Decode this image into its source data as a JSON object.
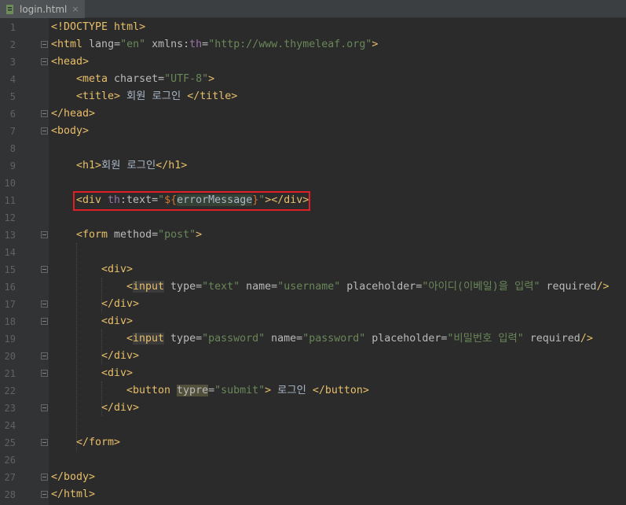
{
  "tab": {
    "filename": "login.html",
    "close_glyph": "×",
    "icon": "html-file-icon"
  },
  "highlight": {
    "line": 11,
    "color": "#e01f26"
  },
  "lines": [
    {
      "n": "1",
      "fold": false,
      "indent": 0,
      "segs": [
        [
          "tag",
          "<!DOCTYPE html>"
        ]
      ]
    },
    {
      "n": "2",
      "fold": true,
      "indent": 0,
      "segs": [
        [
          "tag",
          "<html "
        ],
        [
          "attr",
          "lang="
        ],
        [
          "str",
          "\"en\""
        ],
        [
          "attr",
          " xmlns:"
        ],
        [
          "ns",
          "th"
        ],
        [
          "attr",
          "="
        ],
        [
          "str",
          "\"http://www.thymeleaf.org\""
        ],
        [
          "tag",
          ">"
        ]
      ]
    },
    {
      "n": "3",
      "fold": true,
      "indent": 0,
      "segs": [
        [
          "tag",
          "<head>"
        ]
      ]
    },
    {
      "n": "4",
      "fold": false,
      "indent": 1,
      "segs": [
        [
          "tag",
          "<meta "
        ],
        [
          "attr",
          "charset="
        ],
        [
          "str",
          "\"UTF-8\""
        ],
        [
          "tag",
          ">"
        ]
      ]
    },
    {
      "n": "5",
      "fold": false,
      "indent": 1,
      "segs": [
        [
          "tag",
          "<title>"
        ],
        [
          "txt",
          " 회원 로그인 "
        ],
        [
          "tag",
          "</title>"
        ]
      ]
    },
    {
      "n": "6",
      "fold": true,
      "indent": 0,
      "segs": [
        [
          "tag",
          "</head>"
        ]
      ]
    },
    {
      "n": "7",
      "fold": true,
      "indent": 0,
      "segs": [
        [
          "tag",
          "<body>"
        ]
      ]
    },
    {
      "n": "8",
      "fold": false,
      "indent": 0,
      "segs": []
    },
    {
      "n": "9",
      "fold": false,
      "indent": 1,
      "segs": [
        [
          "tag",
          "<h1>"
        ],
        [
          "txt",
          "회원 로그인"
        ],
        [
          "tag",
          "</h1>"
        ]
      ]
    },
    {
      "n": "10",
      "fold": false,
      "indent": 0,
      "segs": []
    },
    {
      "n": "11",
      "fold": false,
      "indent": 1,
      "segs": [
        [
          "tag",
          "<div "
        ],
        [
          "ns",
          "th"
        ],
        [
          "attr",
          ":text="
        ],
        [
          "str",
          "\""
        ],
        [
          "dollar",
          "$"
        ],
        [
          "brace",
          "{"
        ],
        [
          "var",
          "errorMessage"
        ],
        [
          "brace",
          "}"
        ],
        [
          "str",
          "\""
        ],
        [
          "tag",
          "></div>"
        ]
      ]
    },
    {
      "n": "12",
      "fold": false,
      "indent": 0,
      "segs": []
    },
    {
      "n": "13",
      "fold": true,
      "indent": 1,
      "segs": [
        [
          "tag",
          "<form "
        ],
        [
          "attr",
          "method="
        ],
        [
          "str",
          "\"post\""
        ],
        [
          "tag",
          ">"
        ]
      ]
    },
    {
      "n": "14",
      "fold": false,
      "indent": 0,
      "segs": []
    },
    {
      "n": "15",
      "fold": true,
      "indent": 2,
      "segs": [
        [
          "tag",
          "<div>"
        ]
      ]
    },
    {
      "n": "16",
      "fold": false,
      "indent": 3,
      "segs": [
        [
          "tag",
          "<"
        ],
        [
          "tag hlw",
          "input"
        ],
        [
          "attr",
          " type="
        ],
        [
          "str",
          "\"text\""
        ],
        [
          "attr",
          " name="
        ],
        [
          "str",
          "\"username\""
        ],
        [
          "attr",
          " placeholder="
        ],
        [
          "str",
          "\"아이디(이베일)을 입력\""
        ],
        [
          "attr",
          " required"
        ],
        [
          "tag",
          "/>"
        ]
      ]
    },
    {
      "n": "17",
      "fold": true,
      "indent": 2,
      "segs": [
        [
          "tag",
          "</div>"
        ]
      ]
    },
    {
      "n": "18",
      "fold": true,
      "indent": 2,
      "segs": [
        [
          "tag",
          "<div>"
        ]
      ]
    },
    {
      "n": "19",
      "fold": false,
      "indent": 3,
      "segs": [
        [
          "tag",
          "<"
        ],
        [
          "tag hlw",
          "input"
        ],
        [
          "attr",
          " type="
        ],
        [
          "str",
          "\"password\""
        ],
        [
          "attr",
          " name="
        ],
        [
          "str",
          "\"password\""
        ],
        [
          "attr",
          " placeholder="
        ],
        [
          "str",
          "\"비밀번호 입력\""
        ],
        [
          "attr",
          " required"
        ],
        [
          "tag",
          "/>"
        ]
      ]
    },
    {
      "n": "20",
      "fold": true,
      "indent": 2,
      "segs": [
        [
          "tag",
          "</div>"
        ]
      ]
    },
    {
      "n": "21",
      "fold": true,
      "indent": 2,
      "segs": [
        [
          "tag",
          "<div>"
        ]
      ]
    },
    {
      "n": "22",
      "fold": false,
      "indent": 3,
      "segs": [
        [
          "tag",
          "<button "
        ],
        [
          "attr warnw",
          "typre"
        ],
        [
          "attr",
          "="
        ],
        [
          "str",
          "\"submit\""
        ],
        [
          "tag",
          ">"
        ],
        [
          "txt",
          " 로그인 "
        ],
        [
          "tag",
          "</button>"
        ]
      ]
    },
    {
      "n": "23",
      "fold": true,
      "indent": 2,
      "segs": [
        [
          "tag",
          "</div>"
        ]
      ]
    },
    {
      "n": "24",
      "fold": false,
      "indent": 0,
      "segs": []
    },
    {
      "n": "25",
      "fold": true,
      "indent": 1,
      "segs": [
        [
          "tag",
          "</form>"
        ]
      ]
    },
    {
      "n": "26",
      "fold": false,
      "indent": 0,
      "segs": []
    },
    {
      "n": "27",
      "fold": true,
      "indent": 0,
      "segs": [
        [
          "tag",
          "</body>"
        ]
      ]
    },
    {
      "n": "28",
      "fold": true,
      "indent": 0,
      "segs": [
        [
          "tag",
          "</html>"
        ]
      ]
    }
  ]
}
